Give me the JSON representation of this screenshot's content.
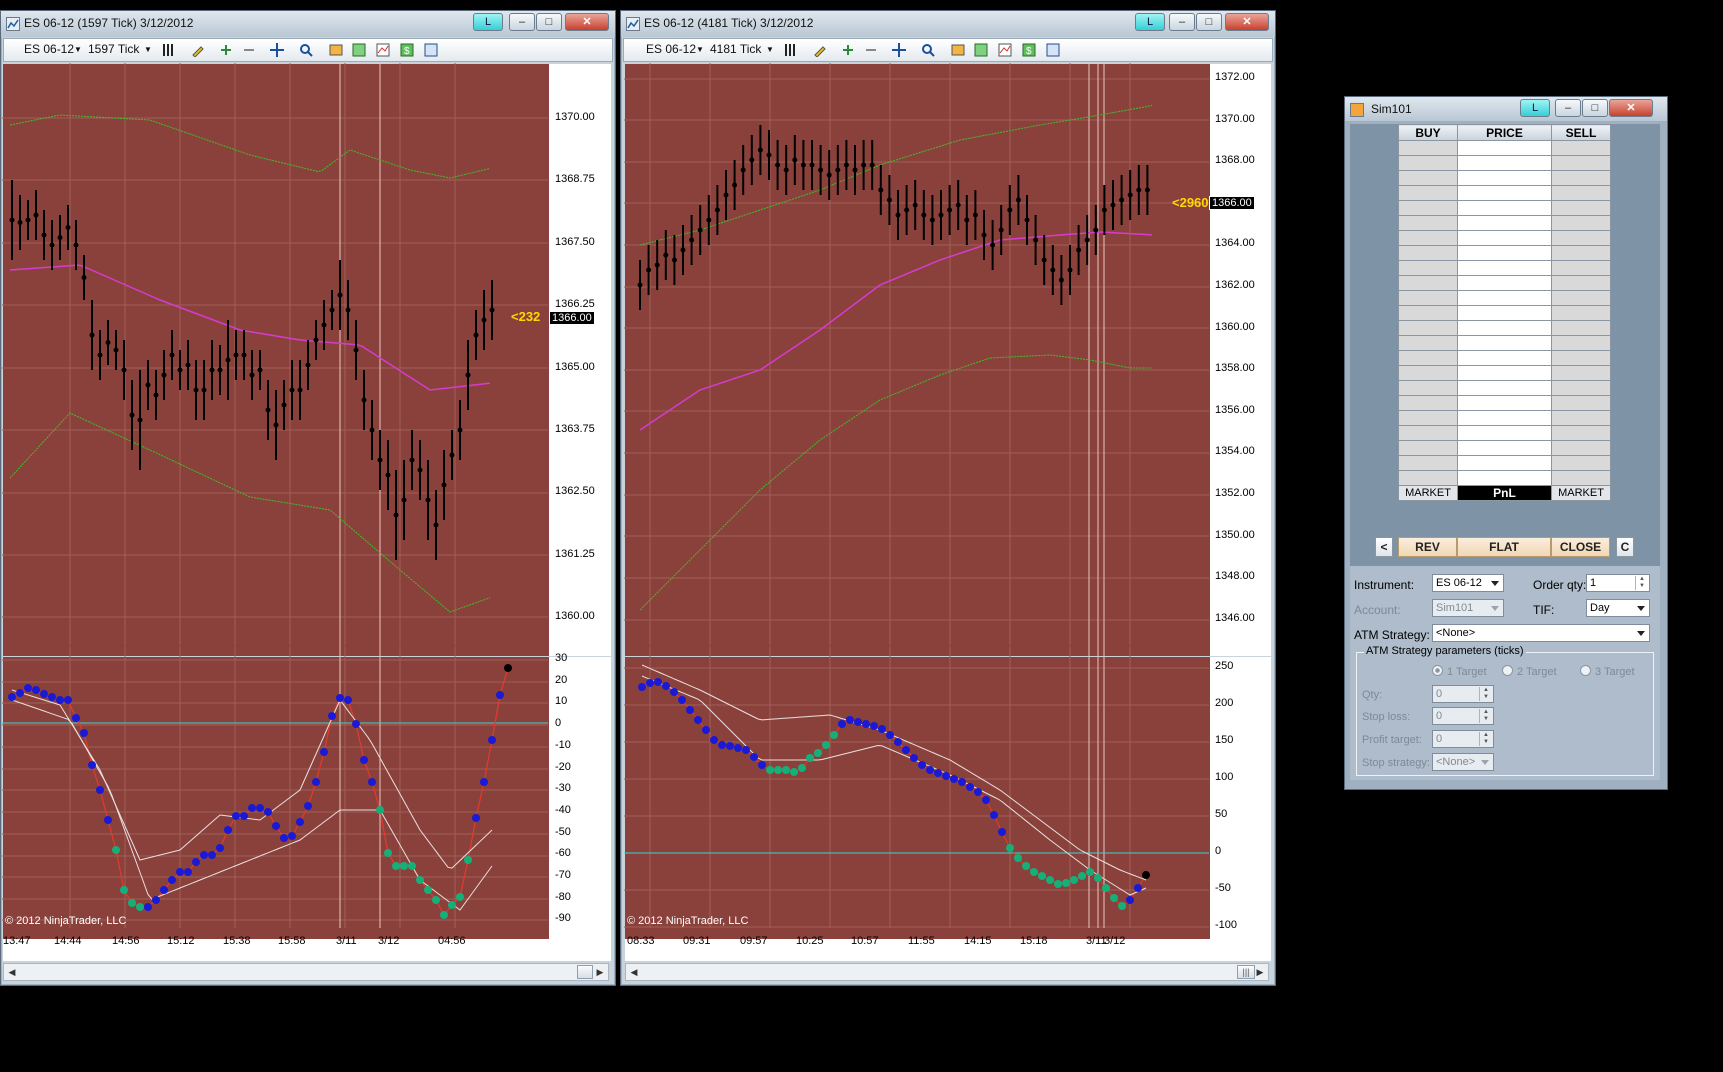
{
  "left_chart": {
    "title": "ES 06-12 (1597 Tick)  3/12/2012",
    "toolbar": {
      "instrument": "ES 06-12",
      "interval": "1597 Tick"
    },
    "link_label": "L",
    "price_axis": [
      "1370.00",
      "1368.75",
      "1367.50",
      "1366.25",
      "1365.00",
      "1363.75",
      "1362.50",
      "1361.25",
      "1360.00"
    ],
    "last_price": "1366.00",
    "countdown": "<232",
    "osc_axis": [
      "30",
      "20",
      "10",
      "0",
      "-10",
      "-20",
      "-30",
      "-40",
      "-50",
      "-60",
      "-70",
      "-80",
      "-90"
    ],
    "time_axis": [
      "13:47",
      "14:44",
      "14:56",
      "15:12",
      "15:38",
      "15:58",
      "3/11",
      "3/12",
      "04:56"
    ],
    "copyright": "© 2012 NinjaTrader, LLC"
  },
  "right_chart": {
    "title": "ES 06-12 (4181 Tick)  3/12/2012",
    "toolbar": {
      "instrument": "ES 06-12",
      "interval": "4181 Tick"
    },
    "link_label": "L",
    "price_axis": [
      "1372.00",
      "1370.00",
      "1368.00",
      "1366.00",
      "1364.00",
      "1362.00",
      "1360.00",
      "1358.00",
      "1356.00",
      "1354.00",
      "1352.00",
      "1350.00",
      "1348.00",
      "1346.00"
    ],
    "last_price": "1366.00",
    "countdown": "<2960",
    "osc_axis": [
      "250",
      "200",
      "150",
      "100",
      "50",
      "0",
      "-50",
      "-100"
    ],
    "time_axis": [
      "08:33",
      "09:31",
      "09:57",
      "10:25",
      "10:57",
      "11:55",
      "14:15",
      "15:18",
      "3/11",
      "3/12"
    ],
    "copyright": "© 2012 NinjaTrader, LLC"
  },
  "sim_window": {
    "title": "Sim101",
    "link_label": "L",
    "headers": {
      "buy": "BUY",
      "price": "PRICE",
      "sell": "SELL"
    },
    "footer": {
      "buy": "MARKET",
      "price": "PnL",
      "sell": "MARKET"
    },
    "buttons": {
      "left": "<",
      "rev": "REV",
      "flat": "FLAT",
      "close": "CLOSE",
      "right": "C"
    },
    "instrument_label": "Instrument:",
    "instrument_value": "ES 06-12",
    "order_qty_label": "Order qty:",
    "order_qty_value": "1",
    "account_label": "Account:",
    "account_value": "Sim101",
    "tif_label": "TIF:",
    "tif_value": "Day",
    "atm_label": "ATM Strategy:",
    "atm_value": "<None>",
    "atm_params_title": "ATM Strategy parameters (ticks)",
    "targets": [
      "1 Target",
      "2 Target",
      "3 Target"
    ],
    "qty_label": "Qty:",
    "qty_value": "0",
    "stop_loss_label": "Stop loss:",
    "stop_loss_value": "0",
    "profit_target_label": "Profit target:",
    "profit_target_value": "0",
    "stop_strategy_label": "Stop strategy:",
    "stop_strategy_value": "<None>"
  },
  "colors": {
    "chart_bg": "#8b413b",
    "upper_band": "#3fbf2a",
    "ma": "#d63bd0",
    "hline": "#35d6d6",
    "dots_blue": "#1a1ad6",
    "dots_green": "#15b07a"
  }
}
